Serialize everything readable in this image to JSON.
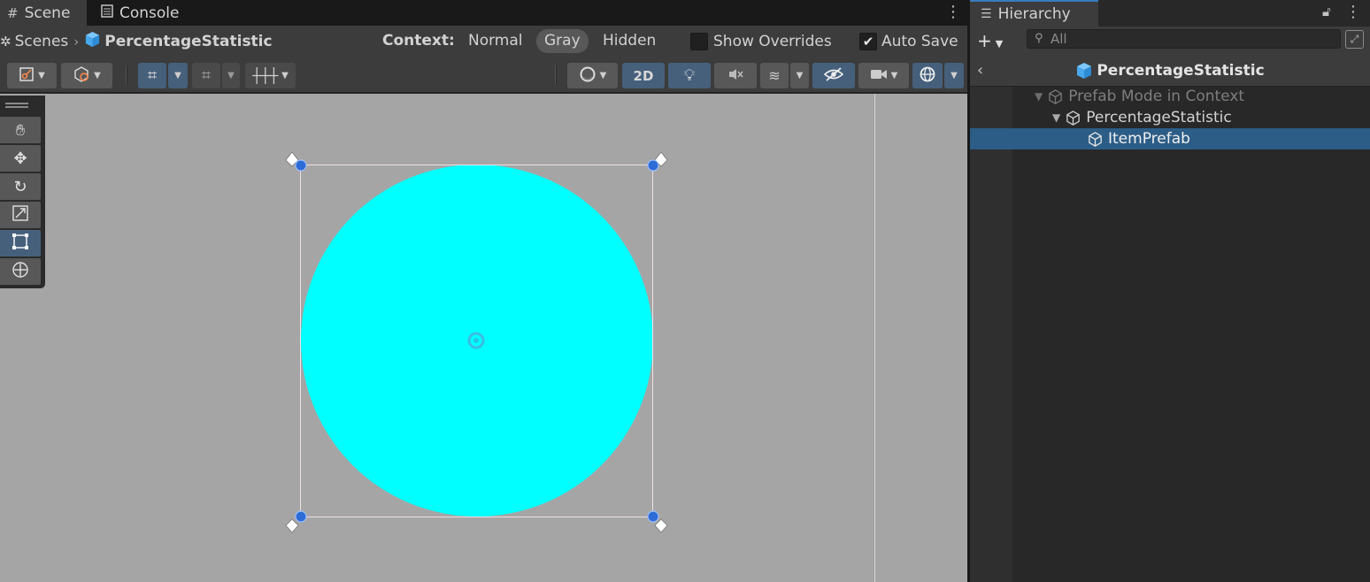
{
  "scene_window": {
    "tabs": [
      {
        "label": "Scene",
        "icon": "grid-hash-icon"
      },
      {
        "label": "Console",
        "icon": "console-icon"
      }
    ],
    "breadcrumb": {
      "root": "Scenes",
      "prefab": "PercentageStatistic"
    },
    "context": {
      "label": "Context:",
      "options": [
        "Normal",
        "Gray",
        "Hidden"
      ],
      "selected": "Gray"
    },
    "show_overrides": {
      "label": "Show Overrides",
      "checked": false
    },
    "auto_save": {
      "label": "Auto Save",
      "checked": true
    },
    "toolbar": {
      "mode_2d_label": "2D"
    },
    "tools": [
      "hand-tool",
      "move-tool",
      "rotate-tool",
      "scale-tool",
      "rect-tool",
      "transform-tool"
    ],
    "active_tool": "rect-tool",
    "selected_object_color": "#00ffff",
    "viewport_color": "#a5a5a5"
  },
  "hierarchy_window": {
    "tab_label": "Hierarchy",
    "search_placeholder": "All",
    "header_title": "PercentageStatistic",
    "rows": [
      {
        "label": "Prefab Mode in Context",
        "depth": 0,
        "expanded": true,
        "dim": true,
        "selected": false
      },
      {
        "label": "PercentageStatistic",
        "depth": 1,
        "expanded": true,
        "dim": false,
        "selected": false
      },
      {
        "label": "ItemPrefab",
        "depth": 2,
        "expanded": false,
        "dim": false,
        "selected": true
      }
    ],
    "selection_color": "#2c5d87"
  }
}
